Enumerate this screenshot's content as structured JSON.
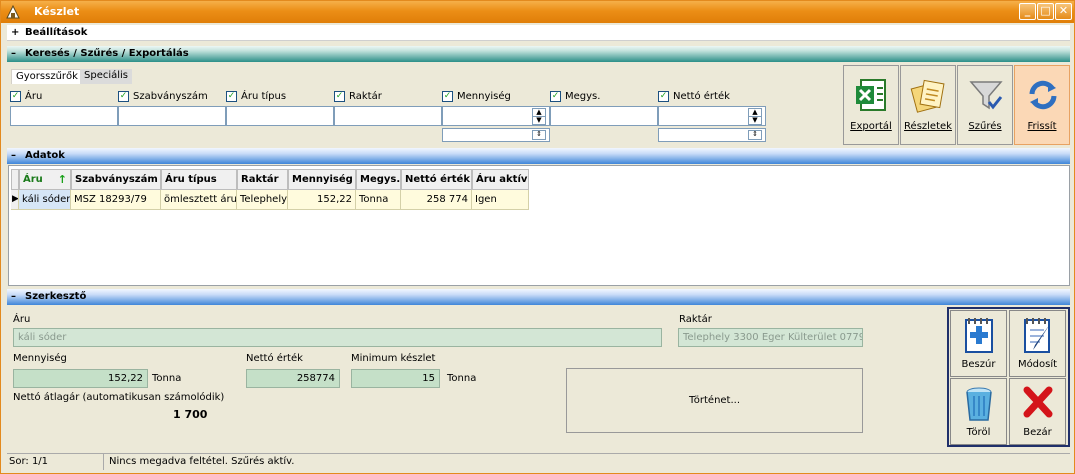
{
  "window": {
    "title": "Készlet",
    "minimize": "_",
    "maximize": "□",
    "close": "✕"
  },
  "sections": {
    "settings": {
      "sign": "+",
      "label": "Beállítások"
    },
    "search": {
      "sign": "–",
      "label": "Keresés / Szűrés / Exportálás"
    },
    "data": {
      "sign": "–",
      "label": "Adatok"
    },
    "editor": {
      "sign": "–",
      "label": "Szerkesztő"
    }
  },
  "tabs": [
    "Gyorsszűrők",
    "Speciális"
  ],
  "filters": [
    {
      "label": "Áru",
      "checked": true
    },
    {
      "label": "Szabványszám",
      "checked": true
    },
    {
      "label": "Áru típus",
      "checked": true
    },
    {
      "label": "Raktár",
      "checked": true
    },
    {
      "label": "Mennyiség",
      "checked": true
    },
    {
      "label": "Megys.",
      "checked": true
    },
    {
      "label": "Nettó érték",
      "checked": true
    }
  ],
  "toolbar": {
    "export": "Exportál",
    "details": "Részletek",
    "filter": "Szűrés",
    "refresh": "Frissít"
  },
  "grid": {
    "columns": [
      "Áru",
      "Szabványszám",
      "Áru típus",
      "Raktár",
      "Mennyiség",
      "Megys.",
      "Nettó érték",
      "Áru aktív"
    ],
    "rows": [
      [
        "káli sóder",
        "MSZ 18293/79",
        "ömlesztett áru",
        "Telephely",
        "152,22",
        "Tonna",
        "258 774",
        "Igen"
      ]
    ]
  },
  "editor": {
    "aru_label": "Áru",
    "aru_value": "káli sóder",
    "raktar_label": "Raktár",
    "raktar_value": "Telephely 3300 Eger Külterület 0779/",
    "mennyiseg_label": "Mennyiség",
    "mennyiseg_value": "152,22",
    "mennyiseg_unit": "Tonna",
    "netto_label": "Nettó érték",
    "netto_value": "258774",
    "minimum_label": "Minimum készlet",
    "minimum_value": "15",
    "minimum_unit": "Tonna",
    "atlagar_label": "Nettó átlagár (automatikusan számolódik)",
    "atlagar_value": "1 700",
    "history_button": "Történet..."
  },
  "actions": {
    "insert": "Beszúr",
    "modify": "Módosít",
    "delete": "Töröl",
    "close": "Bezár"
  },
  "status": {
    "row": "Sor: 1/1",
    "message": "Nincs megadva feltétel. Szűrés aktív."
  },
  "icons": {
    "app": "app-icon",
    "export": "excel-icon",
    "details": "documents-icon",
    "filter": "funnel-icon",
    "refresh": "refresh-icon",
    "insert": "add-document-icon",
    "modify": "edit-notepad-icon",
    "delete": "recycle-bin-icon",
    "close": "red-x-icon",
    "sort": "sort-ascending-icon"
  },
  "colors": {
    "titlebar": "#ec8e16",
    "teal_header": "#2c8f88",
    "blue_header": "#3f86d8",
    "row_bg": "#fffbdd",
    "editor_field": "#c5e0c8"
  }
}
